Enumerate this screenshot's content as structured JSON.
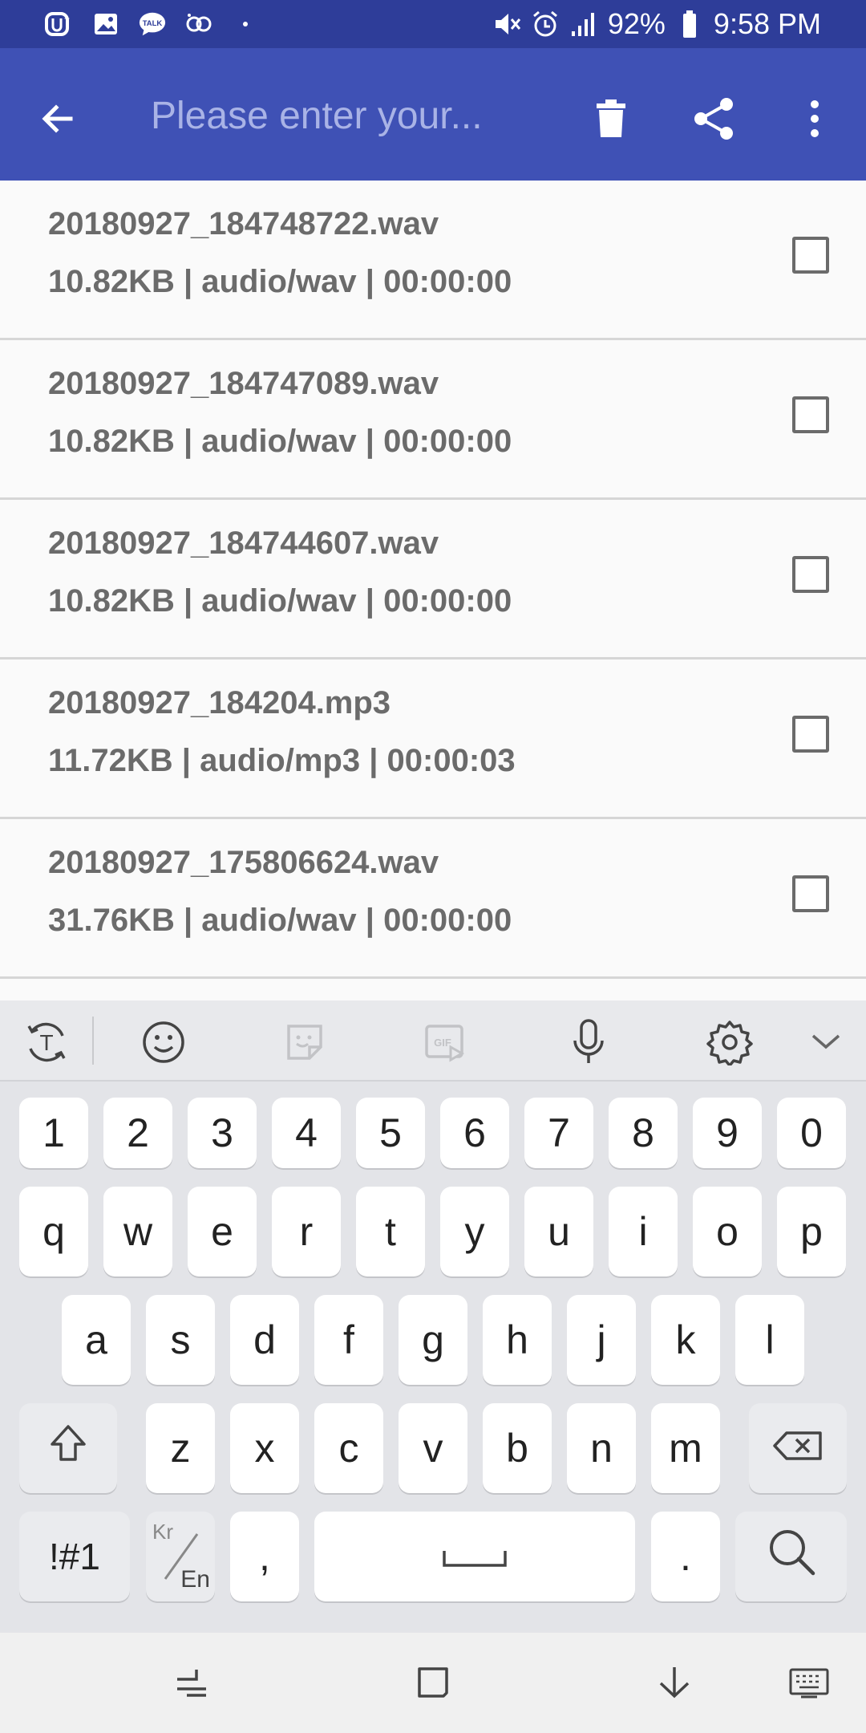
{
  "status_bar": {
    "battery_percent": "92%",
    "time": "9:58 PM",
    "icons": [
      "u-plus-icon",
      "gallery-icon",
      "talk-icon",
      "link-icon",
      "dot-icon",
      "mute-icon",
      "alarm-icon",
      "signal-icon",
      "battery-icon"
    ]
  },
  "app_bar": {
    "search_placeholder": "Please enter your...",
    "icons": [
      "back-arrow-icon",
      "trash-icon",
      "share-icon",
      "more-vert-icon"
    ],
    "color": "#3f51b5"
  },
  "files": [
    {
      "name": "20180927_184748722.wav",
      "meta": "10.82KB | audio/wav | 00:00:00",
      "checked": false
    },
    {
      "name": "20180927_184747089.wav",
      "meta": "10.82KB | audio/wav | 00:00:00",
      "checked": false
    },
    {
      "name": "20180927_184744607.wav",
      "meta": "10.82KB | audio/wav | 00:00:00",
      "checked": false
    },
    {
      "name": "20180927_184204.mp3",
      "meta": "11.72KB | audio/mp3 | 00:00:03",
      "checked": false
    },
    {
      "name": "20180927_175806624.wav",
      "meta": "31.76KB | audio/wav | 00:00:00",
      "checked": false
    }
  ],
  "keyboard": {
    "toolbar_icons": [
      "translate-icon",
      "emoji-icon",
      "sticker-icon",
      "gif-icon",
      "microphone-icon",
      "settings-gear-icon",
      "collapse-chevron-icon"
    ],
    "row_numbers": [
      "1",
      "2",
      "3",
      "4",
      "5",
      "6",
      "7",
      "8",
      "9",
      "0"
    ],
    "row_top": [
      "q",
      "w",
      "e",
      "r",
      "t",
      "y",
      "u",
      "i",
      "o",
      "p"
    ],
    "row_mid": [
      "a",
      "s",
      "d",
      "f",
      "g",
      "h",
      "j",
      "k",
      "l"
    ],
    "row_bottom": [
      "z",
      "x",
      "c",
      "v",
      "b",
      "n",
      "m"
    ],
    "symbols_label": "!#1",
    "lang_top": "Kr",
    "lang_bottom": "En",
    "comma": ",",
    "period": "."
  },
  "nav_bar": {
    "icons": [
      "recent-apps-icon",
      "home-icon",
      "back-down-icon",
      "keyboard-switch-icon"
    ]
  }
}
